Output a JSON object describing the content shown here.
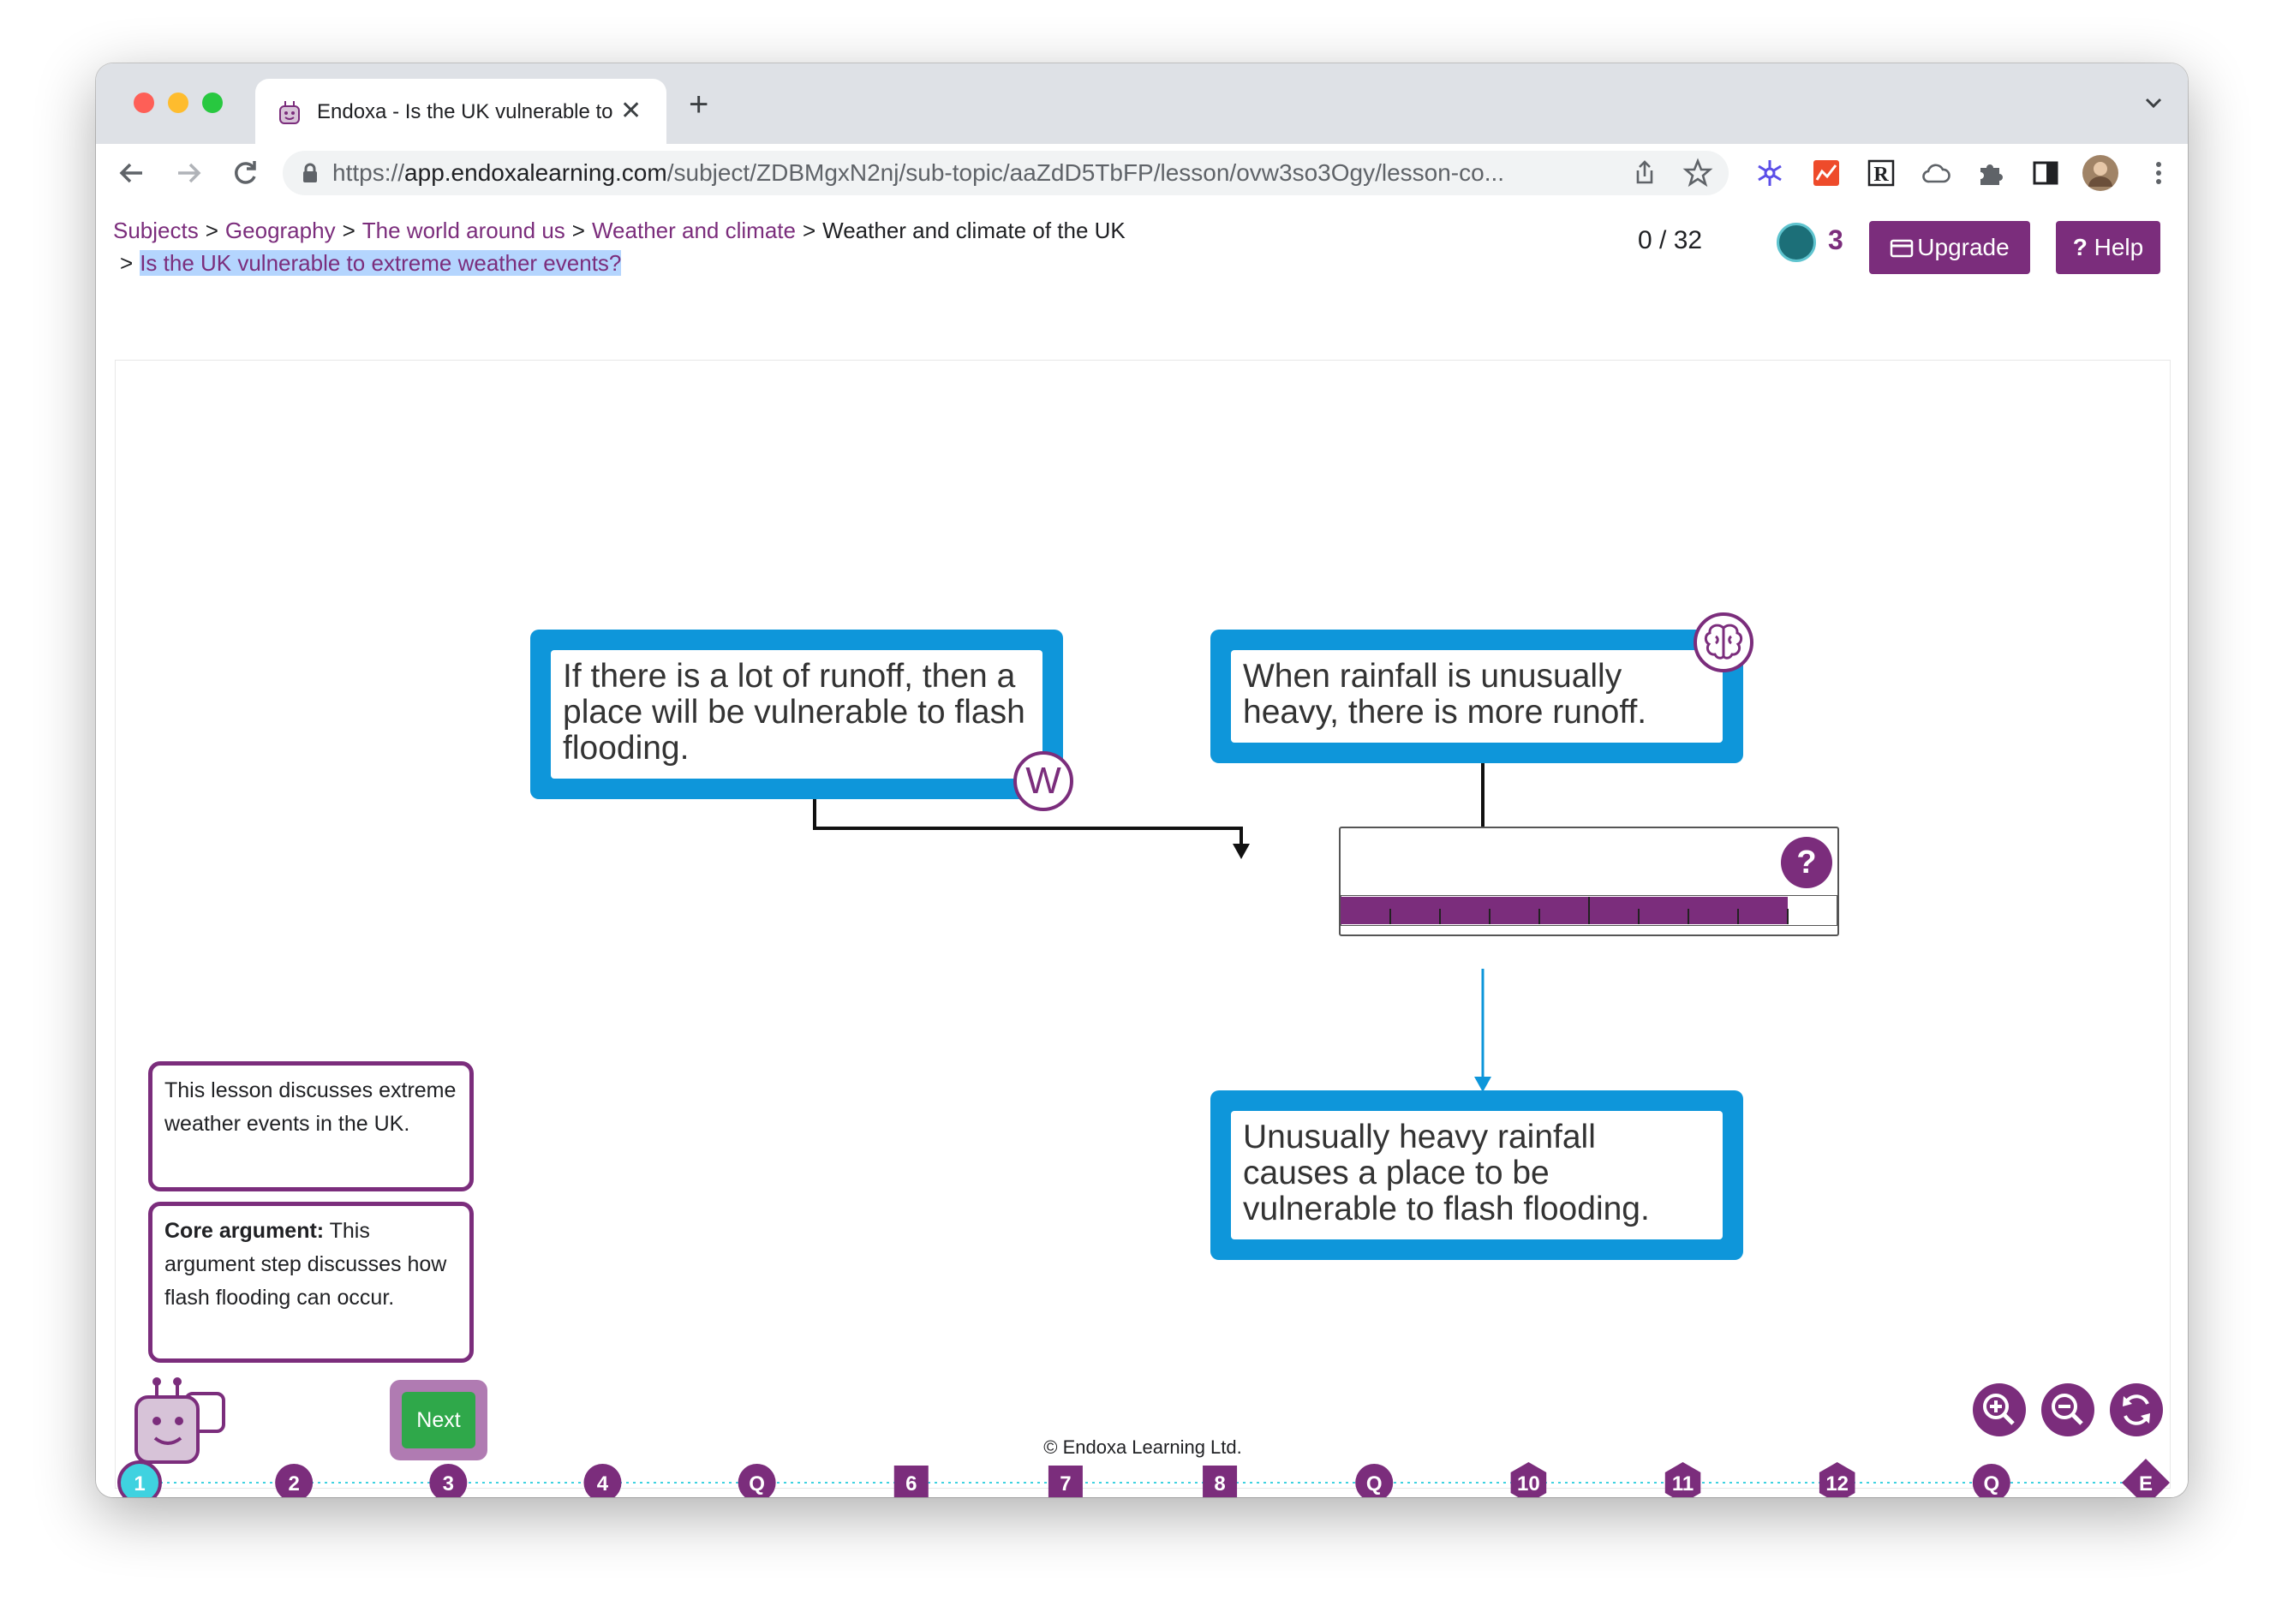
{
  "browser": {
    "tab_title": "Endoxa - Is the UK vulnerable to",
    "url_scheme": "https://",
    "url_host": "app.endoxalearning.com",
    "url_path": "/subject/ZDBMgxN2nj/sub-topic/aaZdD5TbFP/lesson/ovw3so3Ogy/lesson-co..."
  },
  "breadcrumb": {
    "items": [
      "Subjects",
      "Geography",
      "The world around us",
      "Weather and climate",
      "Weather and climate of the UK"
    ],
    "separator": ">",
    "current": "Is the UK vulnerable to extreme weather events?"
  },
  "header": {
    "progress": "0 / 32",
    "coins": "3",
    "upgrade_label": "Upgrade",
    "help_label": "Help"
  },
  "map": {
    "claim_left": "If there is a lot of runoff, then a place will be vulnerable to flash flooding.",
    "claim_right": "When rainfall is unusually heavy, there is more runoff.",
    "conclusion": "Unusually heavy rainfall causes a place to be vulnerable to flash flooding.",
    "warrant_badge": "W",
    "question_badge": "?",
    "strength_fraction": 0.9
  },
  "sidebar": {
    "intro_text": "This lesson discusses extreme weather events in the UK.",
    "core_label": "Core argument:",
    "core_text": " This argument step discusses how flash flooding can occur.",
    "next_label": "Next"
  },
  "footer": {
    "copyright": "© Endoxa Learning Ltd."
  },
  "timeline": {
    "steps": [
      "1",
      "2",
      "3",
      "4",
      "Q",
      "6",
      "7",
      "8",
      "Q",
      "10",
      "11",
      "12",
      "Q",
      "E"
    ],
    "active_step": "1"
  },
  "colors": {
    "brand_purple": "#7b2d7c",
    "claim_blue": "#0e96da",
    "next_green": "#2fa84a",
    "active_step": "#3fd2e0"
  }
}
